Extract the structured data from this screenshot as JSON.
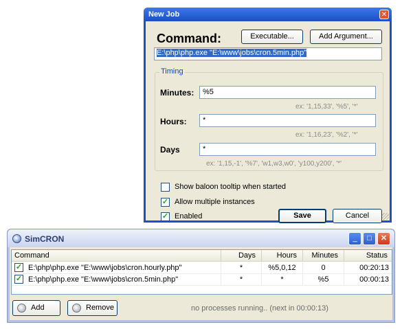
{
  "dialog": {
    "title": "New Job",
    "command_label": "Command:",
    "executable_button": "Executable...",
    "add_argument_button": "Add Argument...",
    "command_value": "E:\\php\\php.exe \"E:\\www\\jobs\\cron.5min.php\"",
    "timing_legend": "Timing",
    "minutes_label": "Minutes:",
    "minutes_value": "%5",
    "minutes_hint": "ex: '1,15,33', '%5', '*'",
    "hours_label": "Hours:",
    "hours_value": "*",
    "hours_hint": "ex: '1,16,23', '%2', '*'",
    "days_label": "Days",
    "days_value": "*",
    "days_hint": "ex: '1,15,-1', '%7', 'w1,w3,w0', 'y100,y200', '*'",
    "checkboxes": [
      {
        "label": "Show baloon tooltip when started",
        "checked": false
      },
      {
        "label": "Allow multiple instances",
        "checked": true
      },
      {
        "label": "Enabled",
        "checked": true
      }
    ],
    "save_button": "Save",
    "cancel_button": "Cancel"
  },
  "simcron": {
    "title": "SimCRON",
    "columns": [
      "Command",
      "Days",
      "Hours",
      "Minutes",
      "Status"
    ],
    "rows": [
      {
        "checked": true,
        "command": "E:\\php\\php.exe \"E:\\www\\jobs\\cron.hourly.php\"",
        "days": "*",
        "hours": "%5,0,12",
        "minutes": "0",
        "status": "00:20:13"
      },
      {
        "checked": true,
        "command": "E:\\php\\php.exe \"E:\\www\\jobs\\cron.5min.php\"",
        "days": "*",
        "hours": "*",
        "minutes": "%5",
        "status": "00:00:13"
      }
    ],
    "add_button": "Add",
    "remove_button": "Remove",
    "status_text": "no processes running.. (next in 00:00:13)"
  },
  "colors": {
    "xp_blue": "#1f4fc8",
    "dialog_face": "#ece9d8",
    "selection": "#316ac5",
    "check_green": "#21a121"
  },
  "icons": [
    "close-icon",
    "app-icon",
    "minimize-icon",
    "maximize-icon",
    "add-icon",
    "remove-icon",
    "checkmark-icon"
  ]
}
